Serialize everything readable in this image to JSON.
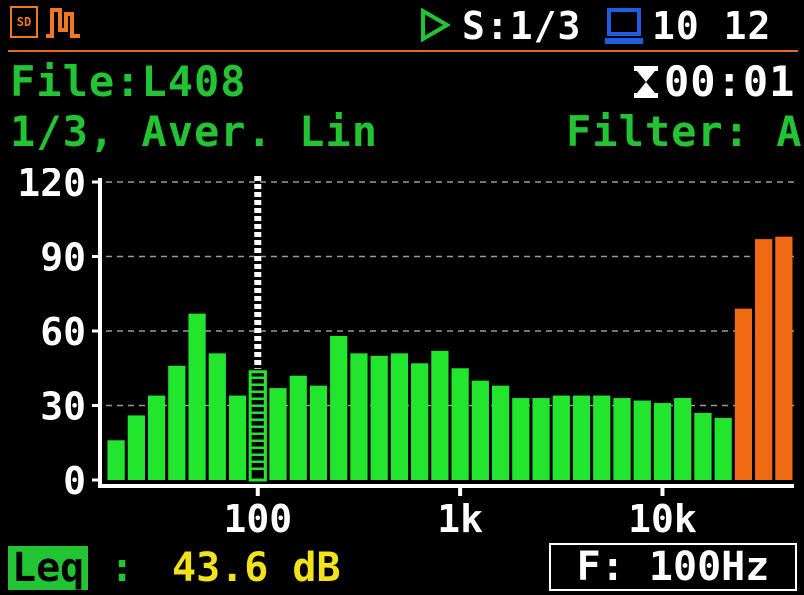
{
  "status": {
    "sd_label": "SD",
    "spectrum_mode": "S:1/3",
    "time": "10 12",
    "icons": [
      "sd-card-icon",
      "waveform-icon",
      "play-icon",
      "computer-icon"
    ],
    "accent_color": "#f07820"
  },
  "header": {
    "file": "File:L408",
    "elapsed": "00:01",
    "mode": "1/3, Aver. Lin",
    "filter": "Filter: A"
  },
  "footer": {
    "leq_label": "Leq",
    "leq_colon": ":",
    "leq_value": "43.6 dB",
    "freq": "F: 100Hz"
  },
  "chart_data": {
    "type": "bar",
    "x_scale": "log",
    "x_ticks": [
      {
        "label": "100",
        "freq": 100
      },
      {
        "label": "1k",
        "freq": 1000
      },
      {
        "label": "10k",
        "freq": 10000
      }
    ],
    "y_ticks": [
      0,
      30,
      60,
      90,
      120
    ],
    "ylim": [
      0,
      120
    ],
    "grid": true,
    "cursor_freq": 100,
    "colors": {
      "normal": "#22e52d",
      "high": "#f06a14",
      "cursor": "#ffffff"
    },
    "bands": [
      {
        "f": 20,
        "v": 16,
        "c": "normal"
      },
      {
        "f": 25,
        "v": 26,
        "c": "normal"
      },
      {
        "f": 31.5,
        "v": 34,
        "c": "normal"
      },
      {
        "f": 40,
        "v": 46,
        "c": "normal"
      },
      {
        "f": 50,
        "v": 67,
        "c": "normal"
      },
      {
        "f": 63,
        "v": 51,
        "c": "normal"
      },
      {
        "f": 80,
        "v": 34,
        "c": "normal"
      },
      {
        "f": 100,
        "v": 44,
        "c": "cursor"
      },
      {
        "f": 125,
        "v": 37,
        "c": "normal"
      },
      {
        "f": 160,
        "v": 42,
        "c": "normal"
      },
      {
        "f": 200,
        "v": 38,
        "c": "normal"
      },
      {
        "f": 250,
        "v": 58,
        "c": "normal"
      },
      {
        "f": 315,
        "v": 51,
        "c": "normal"
      },
      {
        "f": 400,
        "v": 50,
        "c": "normal"
      },
      {
        "f": 500,
        "v": 51,
        "c": "normal"
      },
      {
        "f": 630,
        "v": 47,
        "c": "normal"
      },
      {
        "f": 800,
        "v": 52,
        "c": "normal"
      },
      {
        "f": 1000,
        "v": 45,
        "c": "normal"
      },
      {
        "f": 1250,
        "v": 40,
        "c": "normal"
      },
      {
        "f": 1600,
        "v": 38,
        "c": "normal"
      },
      {
        "f": 2000,
        "v": 33,
        "c": "normal"
      },
      {
        "f": 2500,
        "v": 33,
        "c": "normal"
      },
      {
        "f": 3150,
        "v": 34,
        "c": "normal"
      },
      {
        "f": 4000,
        "v": 34,
        "c": "normal"
      },
      {
        "f": 5000,
        "v": 34,
        "c": "normal"
      },
      {
        "f": 6300,
        "v": 33,
        "c": "normal"
      },
      {
        "f": 8000,
        "v": 32,
        "c": "normal"
      },
      {
        "f": 10000,
        "v": 31,
        "c": "normal"
      },
      {
        "f": 12500,
        "v": 33,
        "c": "normal"
      },
      {
        "f": 16000,
        "v": 27,
        "c": "normal"
      },
      {
        "f": 20000,
        "v": 25,
        "c": "normal"
      },
      {
        "f": 25000,
        "v": 69,
        "c": "high"
      },
      {
        "f": 31500,
        "v": 97,
        "c": "high"
      },
      {
        "f": 40000,
        "v": 98,
        "c": "high"
      }
    ]
  }
}
